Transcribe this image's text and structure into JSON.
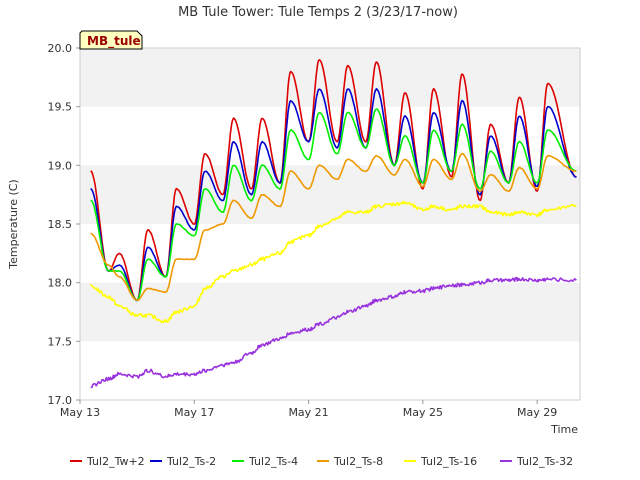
{
  "chart_data": {
    "type": "line",
    "title": "MB Tule Tower: Tule Temps 2 (3/23/17-now)",
    "badge": "MB_tule",
    "xlabel": "Time",
    "ylabel": "Temperature (C)",
    "xlim": [
      "2017-05-13",
      "2017-05-30 12:00"
    ],
    "ylim": [
      17.0,
      20.0
    ],
    "x_ticks": [
      {
        "date": "2017-05-13",
        "label": "May 13"
      },
      {
        "date": "2017-05-17",
        "label": "May 17"
      },
      {
        "date": "2017-05-21",
        "label": "May 21"
      },
      {
        "date": "2017-05-25",
        "label": "May 25"
      },
      {
        "date": "2017-05-29",
        "label": "May 29"
      }
    ],
    "y_ticks": [
      "17.0",
      "17.5",
      "18.0",
      "18.5",
      "19.0",
      "19.5",
      "20.0"
    ],
    "grid": "alternating horizontal bands",
    "legend_position": "bottom",
    "x": [
      "2017-05-13 09:00",
      "2017-05-14 00:00",
      "2017-05-14 09:00",
      "2017-05-15 00:00",
      "2017-05-15 09:00",
      "2017-05-16 00:00",
      "2017-05-16 09:00",
      "2017-05-17 00:00",
      "2017-05-17 09:00",
      "2017-05-18 00:00",
      "2017-05-18 09:00",
      "2017-05-19 00:00",
      "2017-05-19 09:00",
      "2017-05-20 00:00",
      "2017-05-20 09:00",
      "2017-05-21 00:00",
      "2017-05-21 09:00",
      "2017-05-22 00:00",
      "2017-05-22 09:00",
      "2017-05-23 00:00",
      "2017-05-23 09:00",
      "2017-05-24 00:00",
      "2017-05-24 09:00",
      "2017-05-25 00:00",
      "2017-05-25 09:00",
      "2017-05-26 00:00",
      "2017-05-26 09:00",
      "2017-05-27 00:00",
      "2017-05-27 09:00",
      "2017-05-28 00:00",
      "2017-05-28 09:00",
      "2017-05-29 00:00",
      "2017-05-29 09:00",
      "2017-05-30 09:00"
    ],
    "series": [
      {
        "name": "Tul2_Tw+2",
        "color": "#dd0000",
        "values": [
          18.95,
          18.1,
          18.25,
          17.85,
          18.45,
          18.05,
          18.8,
          18.5,
          19.1,
          18.75,
          19.4,
          18.8,
          19.4,
          18.85,
          19.8,
          19.2,
          19.9,
          19.2,
          19.85,
          19.2,
          19.88,
          19.0,
          19.62,
          18.8,
          19.65,
          18.9,
          19.78,
          18.7,
          19.35,
          18.85,
          19.58,
          18.78,
          19.7,
          18.9
        ]
      },
      {
        "name": "Tul2_Ts-2",
        "color": "#0000cc",
        "values": [
          18.8,
          18.1,
          18.15,
          17.85,
          18.3,
          18.05,
          18.65,
          18.45,
          18.95,
          18.7,
          19.2,
          18.75,
          19.2,
          18.85,
          19.55,
          19.2,
          19.65,
          19.15,
          19.65,
          19.15,
          19.65,
          19.0,
          19.42,
          18.85,
          19.45,
          18.95,
          19.55,
          18.75,
          19.25,
          18.85,
          19.42,
          18.82,
          19.5,
          18.9
        ]
      },
      {
        "name": "Tul2_Ts-4",
        "color": "#00ee00",
        "values": [
          18.7,
          18.1,
          18.1,
          17.85,
          18.2,
          18.05,
          18.5,
          18.4,
          18.8,
          18.6,
          19.0,
          18.7,
          19.0,
          18.8,
          19.3,
          19.05,
          19.45,
          19.1,
          19.45,
          19.15,
          19.48,
          19.0,
          19.25,
          18.85,
          19.3,
          18.95,
          19.35,
          18.8,
          19.12,
          18.85,
          19.2,
          18.85,
          19.3,
          18.95
        ]
      },
      {
        "name": "Tul2_Ts-8",
        "color": "#ee9900",
        "values": [
          18.42,
          18.15,
          18.05,
          17.85,
          17.95,
          17.92,
          18.2,
          18.2,
          18.45,
          18.5,
          18.7,
          18.55,
          18.75,
          18.65,
          18.95,
          18.8,
          19.0,
          18.88,
          19.05,
          18.95,
          19.08,
          18.92,
          19.05,
          18.82,
          19.05,
          18.88,
          19.1,
          18.78,
          18.92,
          18.78,
          18.98,
          18.8,
          19.08,
          18.95
        ]
      },
      {
        "name": "Tul2_Ts-16",
        "color": "#ffff00",
        "values": [
          17.97,
          17.88,
          17.8,
          17.72,
          17.72,
          17.67,
          17.75,
          17.8,
          17.95,
          18.05,
          18.1,
          18.15,
          18.2,
          18.25,
          18.35,
          18.4,
          18.48,
          18.55,
          18.6,
          18.6,
          18.65,
          18.67,
          18.68,
          18.62,
          18.65,
          18.62,
          18.65,
          18.65,
          18.6,
          18.58,
          18.6,
          18.58,
          18.62,
          18.66
        ]
      },
      {
        "name": "Tul2_Ts-32",
        "color": "#9933dd",
        "values": [
          17.12,
          17.18,
          17.22,
          17.2,
          17.25,
          17.2,
          17.22,
          17.22,
          17.25,
          17.3,
          17.32,
          17.4,
          17.47,
          17.52,
          17.57,
          17.6,
          17.65,
          17.7,
          17.75,
          17.8,
          17.85,
          17.88,
          17.92,
          17.93,
          17.95,
          17.98,
          17.98,
          18.0,
          18.02,
          18.02,
          18.03,
          18.02,
          18.03,
          18.02
        ]
      }
    ]
  }
}
